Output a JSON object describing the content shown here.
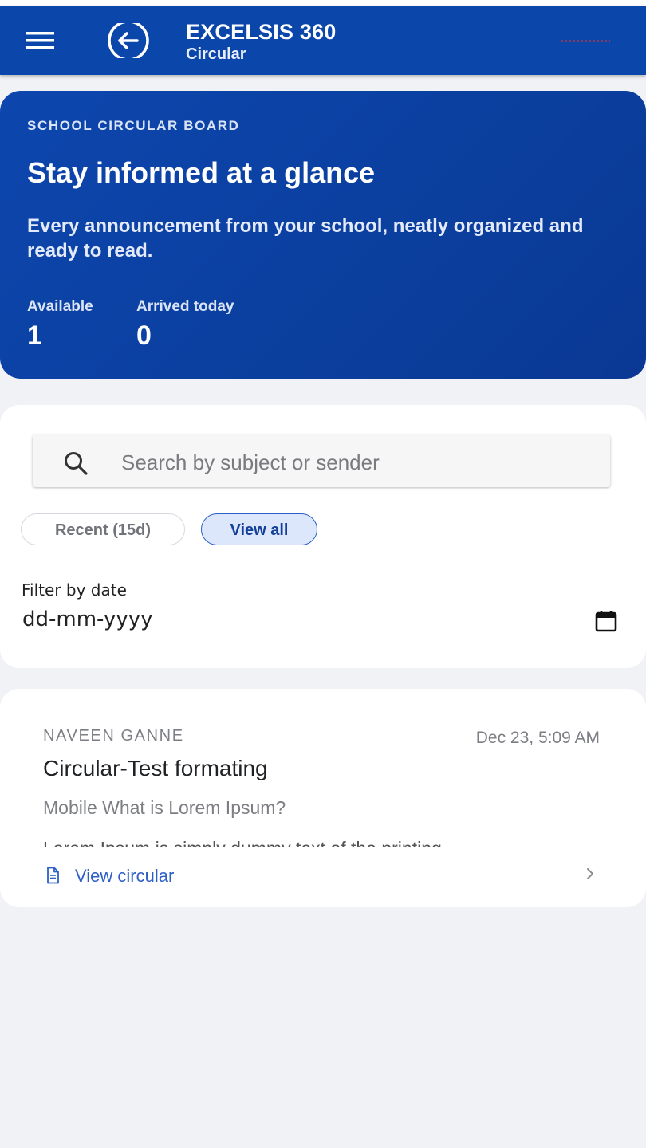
{
  "app_bar": {
    "title": "EXCELSIS 360",
    "subtitle": "Circular",
    "color": "#0b47ab",
    "icons": [
      "menu-icon",
      "back-arrow-icon"
    ]
  },
  "hero": {
    "eyebrow": "SCHOOL CIRCULAR BOARD",
    "title": "Stay informed at a glance",
    "description": "Every announcement from your school, neatly organized and ready to read.",
    "stats": [
      {
        "label": "Available",
        "value": "1"
      },
      {
        "label": "Arrived today",
        "value": "0"
      }
    ]
  },
  "filters": {
    "search_placeholder": "Search by subject or sender",
    "chips": [
      {
        "label": "Recent (15d)",
        "selected": false
      },
      {
        "label": "View all",
        "selected": true
      }
    ],
    "date_label": "Filter by date",
    "date_value": "dd-mm-yyyy"
  },
  "circulars": [
    {
      "sender": "NAVEEN GANNE",
      "date": "Dec 23, 5:09 AM",
      "title": "Circular-Test formating",
      "preview": "Mobile What is Lorem Ipsum?",
      "clipped_line": "Lorem Ipsum is simply dummy text of the printing",
      "action_label": "View circular"
    }
  ]
}
